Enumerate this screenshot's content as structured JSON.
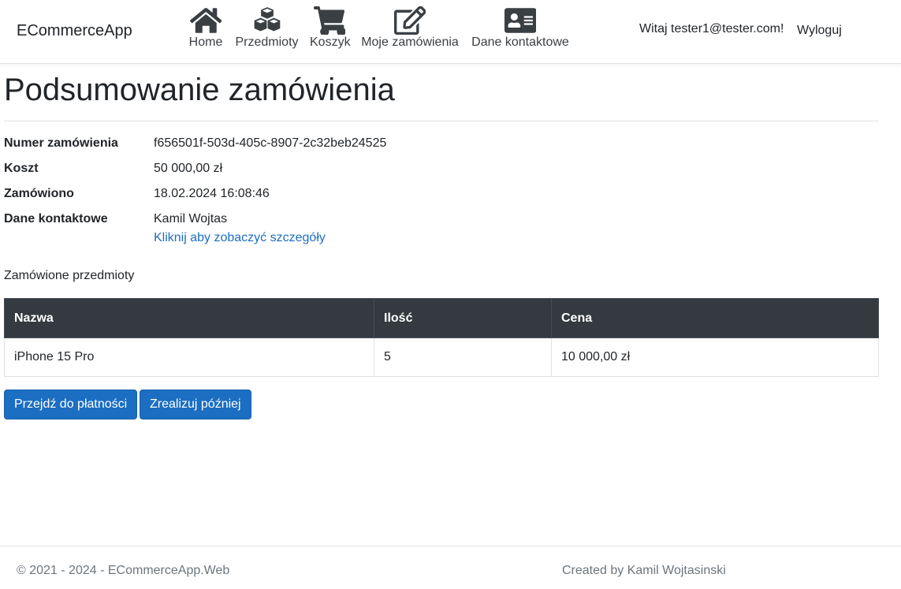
{
  "nav": {
    "brand": "ECommerceApp",
    "items": [
      {
        "label": "Home",
        "icon": "home-icon"
      },
      {
        "label": "Przedmioty",
        "icon": "cubes-icon"
      },
      {
        "label": "Koszyk",
        "icon": "shopping-cart-icon"
      },
      {
        "label": "Moje zamówienia",
        "icon": "edit-icon"
      },
      {
        "label": "Dane kontaktowe",
        "icon": "address-card-icon"
      }
    ],
    "greeting": "Witaj tester1@tester.com!",
    "logout": "Wyloguj"
  },
  "page": {
    "title": "Podsumowanie zamówienia",
    "details": [
      {
        "label": "Numer zamówienia",
        "value": "f656501f-503d-405c-8907-2c32beb24525"
      },
      {
        "label": "Koszt",
        "value": "50 000,00 zł"
      },
      {
        "label": "Zamówiono",
        "value": "18.02.2024 16:08:46"
      },
      {
        "label": "Dane kontaktowe",
        "value": "Kamil Wojtas",
        "link": "Kliknij aby zobaczyć szczegóły"
      }
    ],
    "items_heading": "Zamówione przedmioty",
    "table": {
      "headers": [
        "Nazwa",
        "Ilość",
        "Cena"
      ],
      "rows": [
        [
          "iPhone 15 Pro",
          "5",
          "10 000,00 zł"
        ]
      ]
    },
    "buttons": {
      "pay": "Przejdź do płatności",
      "later": "Zrealizuj później"
    }
  },
  "footer": {
    "copyright": "© 2021 - 2024 - ECommerceApp.Web",
    "author": "Created by Kamil Wojtasinski"
  },
  "colors": {
    "primary": "#1b6ec2",
    "table_header": "#343a40",
    "nav_icon": "#3a3f44"
  }
}
